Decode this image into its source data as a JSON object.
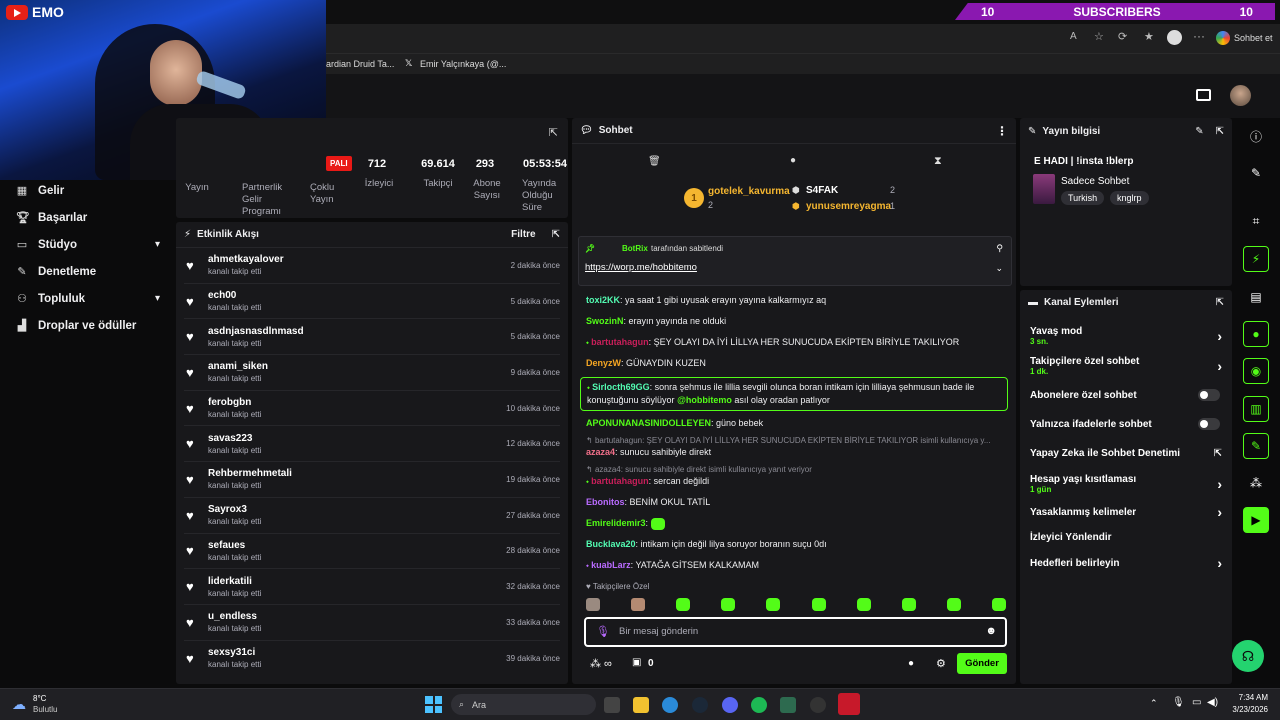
{
  "overlay": {
    "sub_left": "10",
    "sub_label": "SUBSCRIBERS",
    "sub_right": "10",
    "yt_label": "EMO"
  },
  "browser": {
    "tabs_hint": "",
    "bookmarks": [
      "ardian Druid Ta...",
      "Emir Yalçınkaya (@..."
    ],
    "sohbet_label": "Sohbet et"
  },
  "nav": {
    "items": [
      {
        "label": "Gelir",
        "icon": "dollar-icon"
      },
      {
        "label": "Başarılar",
        "icon": "trophy-icon"
      },
      {
        "label": "Stüdyo",
        "icon": "studio-icon",
        "chevron": true
      },
      {
        "label": "Denetleme",
        "icon": "wrench-icon"
      },
      {
        "label": "Topluluk",
        "icon": "community-icon",
        "chevron": true
      },
      {
        "label": "Droplar ve ödüller",
        "icon": "drops-icon"
      }
    ]
  },
  "stats": {
    "partial_badge": "PALI",
    "values": [
      "712",
      "69.614",
      "293",
      "05:53:54"
    ],
    "labels": [
      "Yayın",
      "Partnerlik Gelir Programı",
      "Çoklu Yayın",
      "İzleyici",
      "Takipçi",
      "Abone Sayısı",
      "Yayında Olduğu Süre"
    ]
  },
  "activity": {
    "title": "Etkinlik Akışı",
    "filter_label": "Filtre",
    "rows": [
      {
        "user": "ahmetkayalover",
        "action": "kanalı takip etti",
        "time": "2 dakika önce"
      },
      {
        "user": "ech00",
        "action": "kanalı takip etti",
        "time": "5 dakika önce"
      },
      {
        "user": "asdnjasnasdlnmasd",
        "action": "kanalı takip etti",
        "time": "5 dakika önce"
      },
      {
        "user": "anami_siken",
        "action": "kanalı takip etti",
        "time": "9 dakika önce"
      },
      {
        "user": "ferobgbn",
        "action": "kanalı takip etti",
        "time": "10 dakika önce"
      },
      {
        "user": "savas223",
        "action": "kanalı takip etti",
        "time": "12 dakika önce"
      },
      {
        "user": "Rehbermehmetali",
        "action": "kanalı takip etti",
        "time": "19 dakika önce"
      },
      {
        "user": "Sayrox3",
        "action": "kanalı takip etti",
        "time": "27 dakika önce"
      },
      {
        "user": "sefaues",
        "action": "kanalı takip etti",
        "time": "28 dakika önce"
      },
      {
        "user": "liderkatili",
        "action": "kanalı takip etti",
        "time": "32 dakika önce"
      },
      {
        "user": "u_endless",
        "action": "kanalı takip etti",
        "time": "33 dakika önce"
      },
      {
        "user": "sexsy31ci",
        "action": "kanalı takip etti",
        "time": "39 dakika önce"
      }
    ]
  },
  "chat": {
    "title": "Sohbet",
    "leaders": [
      {
        "rank": "1",
        "name": "gotelek_kavurma",
        "count": "2"
      },
      {
        "rank": "",
        "name": "S4FAK",
        "count": "2"
      },
      {
        "rank": "",
        "name": "yunusemreyagma",
        "count": "1"
      }
    ],
    "pinned": {
      "by": "BotRix",
      "suffix": "tarafından sabitlendi",
      "link": "https://worp.me/hobbitemo"
    },
    "messages": [
      {
        "user": "toxi2KK",
        "color": "#53fcb2",
        "text": "ya saat 1 gibi uyusak erayın yayına kalkarmıyız aq"
      },
      {
        "user": "SwozinN",
        "color": "#53fc18",
        "text": "erayın yayında ne olduki"
      },
      {
        "user": "bartutahagun",
        "color": "#c81f5a",
        "text": "ŞEY OLAYI DA İYİ LİLLYA HER SUNUCUDA EKİPTEN BİRİYLE TAKILIYOR"
      },
      {
        "user": "DenyzW",
        "color": "#f5a623",
        "text": "GÜNAYDIN KUZEN"
      },
      {
        "user": "Sirlocth69GG",
        "color": "#53fcb2",
        "text": "sonra şehmus ile lillia sevgili olunca boran intikam için lilliaya şehmusun bade ile konuştuğunu söylüyor",
        "mention": "@hobbitemo",
        "tail": "asıl olay oradan patlıyor"
      },
      {
        "user": "APONUNANASINIDOLLEYEN",
        "color": "#53fc18",
        "text": "güno bebek"
      },
      {
        "reply": "bartutahagun: ŞEY OLAYI DA İYİ LİLLYA HER SUNUCUDA EKİPTEN BİRİYLE TAKILIYOR isimli kullanıcıya y..."
      },
      {
        "user": "azaza4",
        "color": "#f2708a",
        "text": "sunucu sahibiyle direkt"
      },
      {
        "reply": "azaza4: sunucu sahibiyle direkt isimli kullanıcıya yanıt veriyor"
      },
      {
        "user": "bartutahagun",
        "color": "#c81f5a",
        "text": "sercan değildi"
      },
      {
        "user": "Ebonitos",
        "color": "#b96bff",
        "text": "BENİM OKUL TATİL"
      },
      {
        "user": "Emirelidemir3",
        "color": "#53fc18",
        "text": ""
      },
      {
        "user": "Bucklava20",
        "color": "#53fcb2",
        "text": "intikam için değil lilya soruyor boranın suçu 0dı"
      },
      {
        "user": "kuabLarz",
        "color": "#b96bff",
        "text": "YATAĞA GİTSEM KALKAMAM"
      }
    ],
    "followers_only": "Takipçilere Özel",
    "input_placeholder": "Bir mesaj gönderin",
    "points": "0",
    "send_label": "Gönder"
  },
  "info": {
    "title": "Yayın bilgisi",
    "stream_title": "E HADI | !insta !blerp",
    "category": "Sadece Sohbet",
    "tags": [
      "Turkish",
      "knglrp"
    ]
  },
  "actions": {
    "title": "Kanal Eylemleri",
    "items": [
      {
        "label": "Yavaş mod",
        "sub": "3 sn.",
        "kind": "arrow"
      },
      {
        "label": "Takipçilere özel sohbet",
        "sub": "1 dk.",
        "kind": "arrow"
      },
      {
        "label": "Abonelere özel sohbet",
        "sub": "",
        "kind": "toggle"
      },
      {
        "label": "Yalnızca ifadelerle sohbet",
        "sub": "",
        "kind": "toggle"
      },
      {
        "label": "Yapay Zeka ile Sohbet Denetimi",
        "sub": "",
        "kind": "external"
      },
      {
        "label": "Hesap yaşı kısıtlaması",
        "sub": "1 gün",
        "kind": "arrow"
      },
      {
        "label": "Yasaklanmış kelimeler",
        "sub": "",
        "kind": "arrow"
      },
      {
        "label": "İzleyici Yönlendir",
        "sub": "",
        "kind": "none"
      },
      {
        "label": "Hedefleri belirleyin",
        "sub": "",
        "kind": "arrow"
      }
    ]
  },
  "taskbar": {
    "weather_temp": "8°C",
    "weather_desc": "Bulutlu",
    "search_label": "Ara",
    "time": "7:34 AM",
    "date": "3/23/2026"
  },
  "colors": {
    "accent": "#53fc18",
    "panel": "#18181b",
    "bg": "#0b0b0c"
  }
}
